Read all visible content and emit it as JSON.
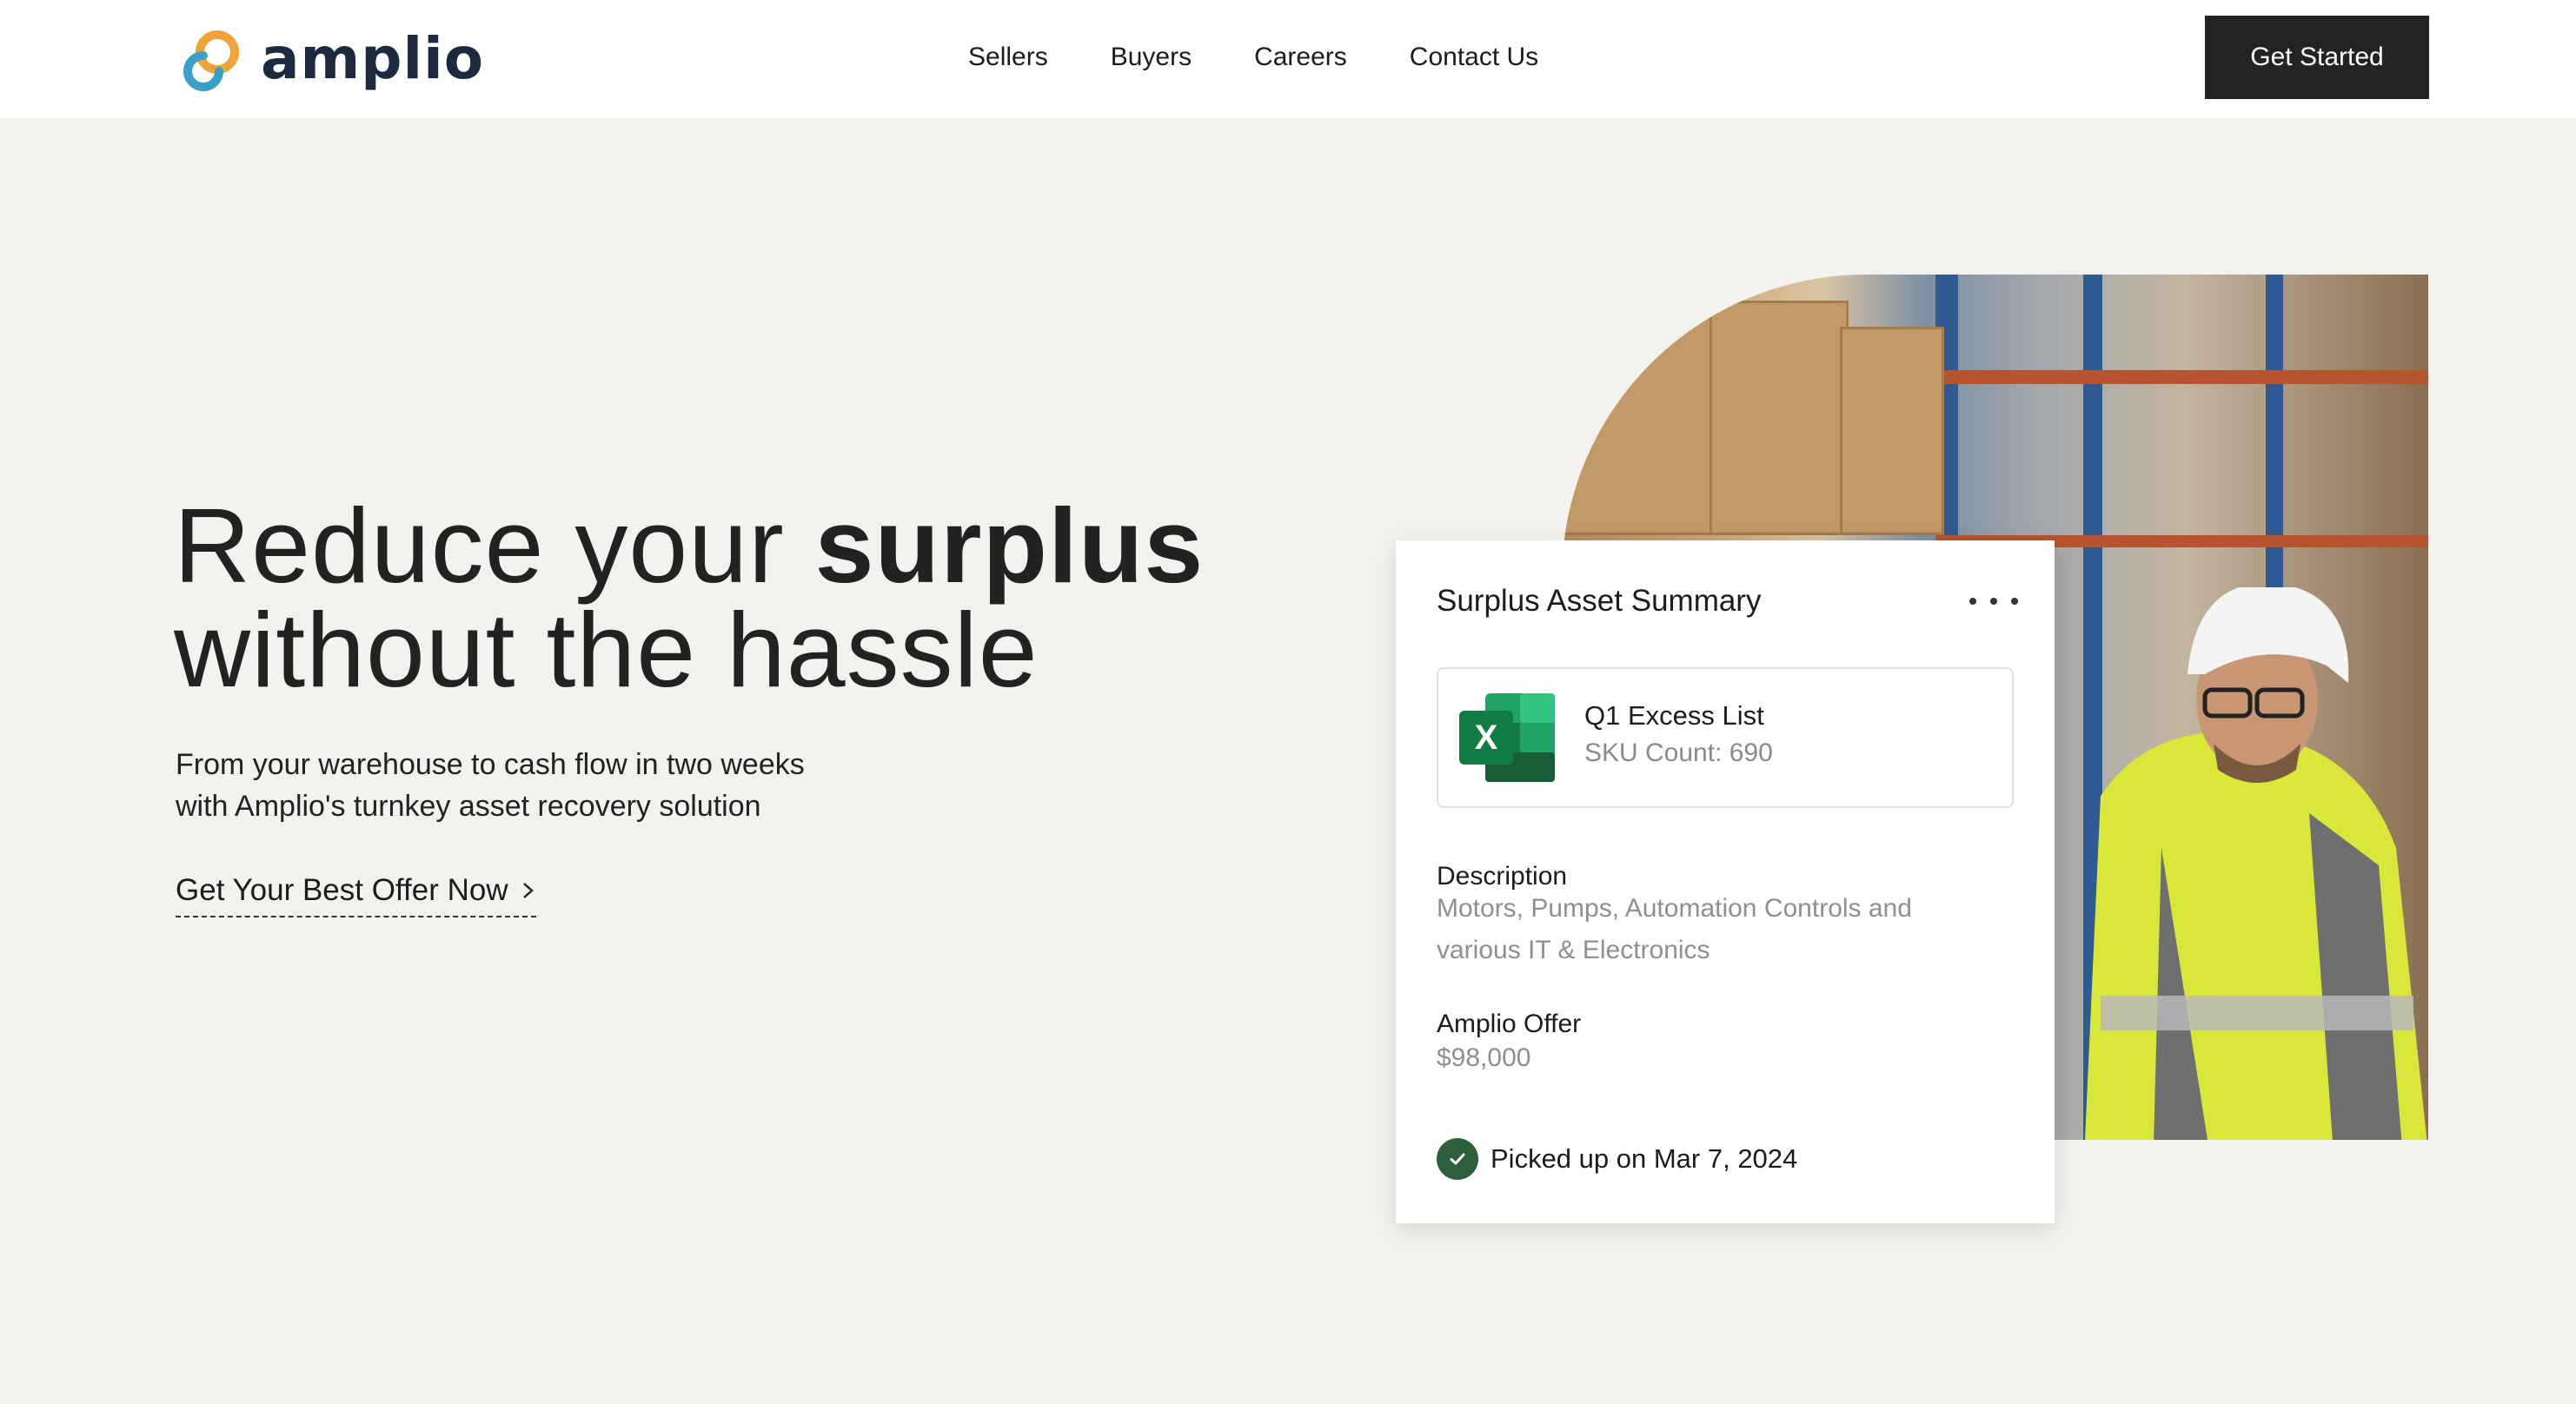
{
  "brand": {
    "name": "amplio",
    "colors": {
      "primary": "#1b2a3f",
      "logo_blue": "#3aa0c8",
      "logo_orange": "#f0a23b"
    }
  },
  "nav": {
    "items": [
      "Sellers",
      "Buyers",
      "Careers",
      "Contact Us"
    ]
  },
  "header": {
    "cta_label": "Get Started"
  },
  "hero": {
    "headline_line1_regular": "Reduce your ",
    "headline_line1_bold": "surplus",
    "headline_line2": "without the hassle",
    "subtext_line1": "From your warehouse to cash flow in two weeks",
    "subtext_line2": "with Amplio's turnkey asset recovery solution",
    "link_label": "Get Your Best Offer Now"
  },
  "card": {
    "title": "Surplus Asset Summary",
    "more_icon": "more-horizontal-icon",
    "file": {
      "icon": "excel-icon",
      "name": "Q1 Excess List",
      "meta": "SKU Count: 690"
    },
    "description_label": "Description",
    "description_value": "Motors, Pumps, Automation Controls and various IT & Electronics",
    "offer_label": "Amplio Offer",
    "offer_value": "$98,000",
    "status_icon": "check-circle-icon",
    "status_text": "Picked up on Mar 7, 2024",
    "status_color": "#2d5f3a"
  }
}
